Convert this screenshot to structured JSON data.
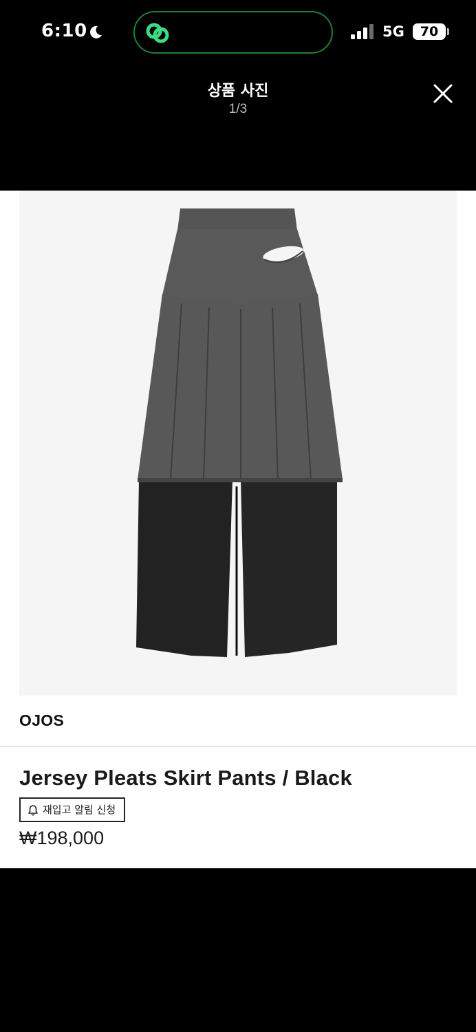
{
  "status_bar": {
    "time": "6:10",
    "network": "5G",
    "battery": "70",
    "icons": [
      "moon-icon",
      "link-icon",
      "signal-icon",
      "battery-icon"
    ],
    "island_accent": "#3ddc84"
  },
  "viewer": {
    "title": "상품 사진",
    "counter": "1/3",
    "close_icon": "close-icon"
  },
  "product": {
    "brand": "OJOS",
    "name": "Jersey Pleats Skirt Pants / Black",
    "restock_label": "재입고 알림 신청",
    "restock_icon": "bell-icon",
    "price": "₩198,000"
  }
}
